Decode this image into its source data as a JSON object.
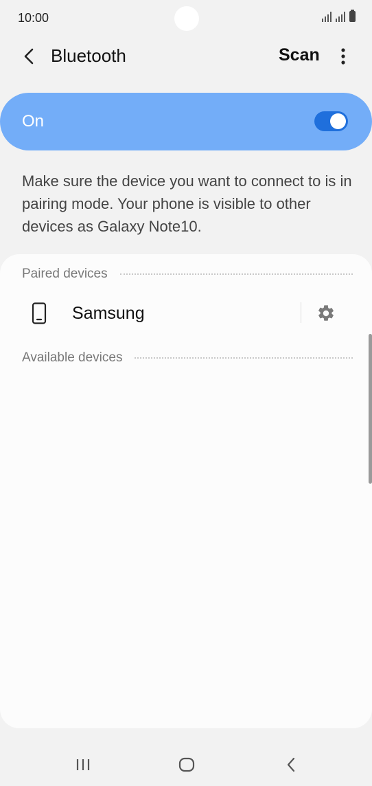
{
  "status_bar": {
    "time": "10:00"
  },
  "app_bar": {
    "title": "Bluetooth",
    "scan_label": "Scan",
    "icons": {
      "back": "chevron-left-icon",
      "more": "more-vertical-icon"
    }
  },
  "master_switch": {
    "label": "On",
    "state": true,
    "track_color": "#1f6fdc",
    "background_color": "#73adf8"
  },
  "description": "Make sure the device you want to connect to is in pairing mode. Your phone is visible to other devices as Galaxy Note10.",
  "paired_section": {
    "title": "Paired devices",
    "devices": [
      {
        "name": "Samsung",
        "icon": "phone-icon",
        "settings_icon": "gear-icon"
      }
    ]
  },
  "available_section": {
    "title": "Available devices"
  },
  "nav_bar": {
    "icons": [
      "recent-apps-icon",
      "home-icon",
      "back-icon"
    ]
  }
}
